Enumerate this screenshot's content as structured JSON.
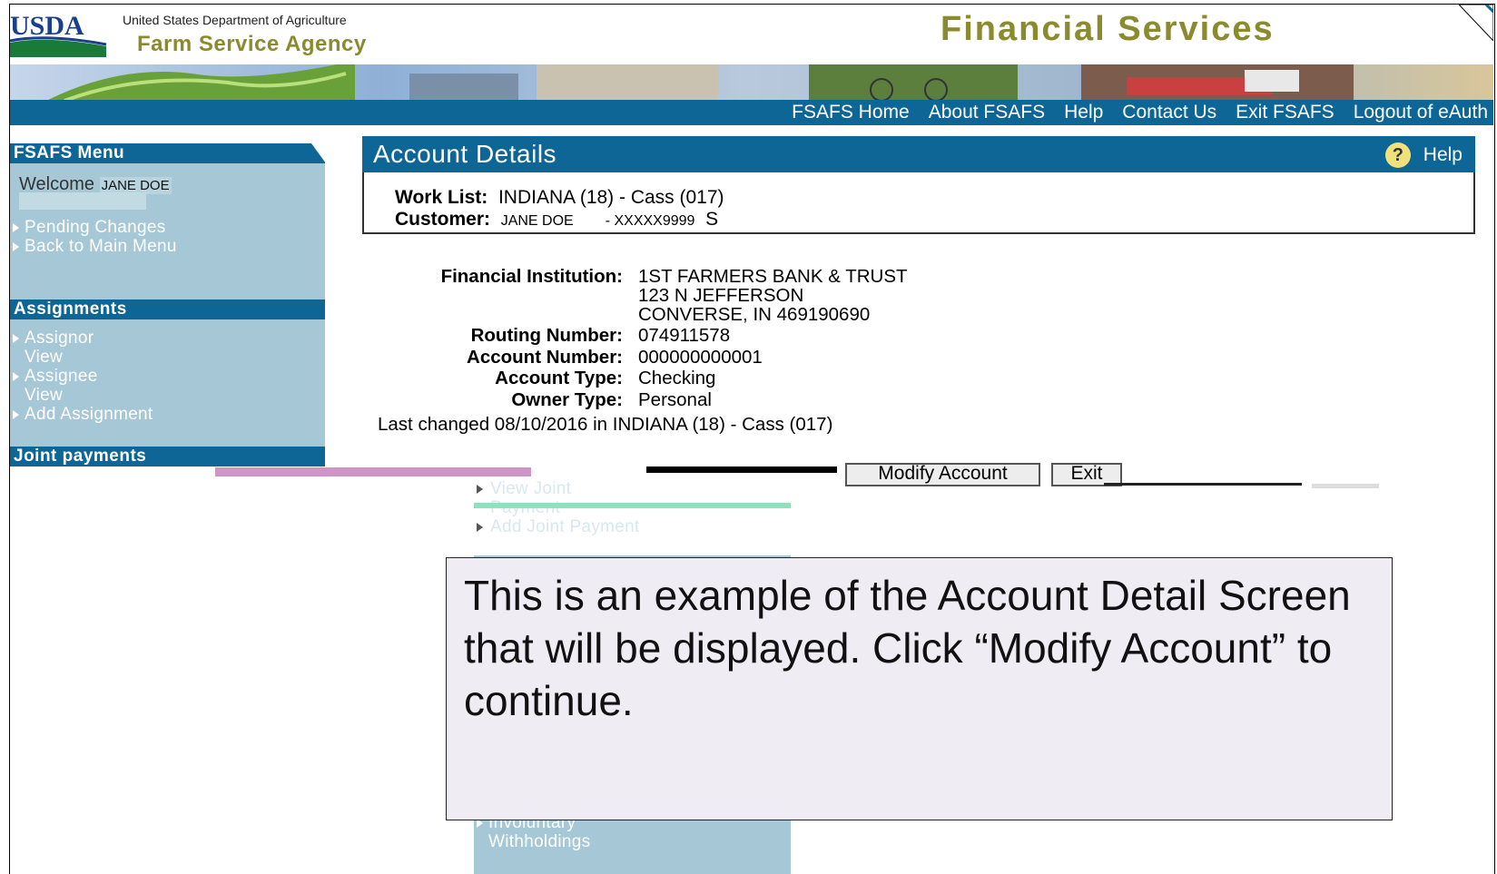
{
  "header": {
    "logo_text": "USDA",
    "department": "United States Department of Agriculture",
    "agency": "Farm Service Agency",
    "site_title": "Financial Services"
  },
  "topnav": {
    "links": [
      "FSAFS Home",
      "About FSAFS",
      "Help",
      "Contact Us",
      "Exit FSAFS",
      "Logout of eAuth"
    ]
  },
  "sidebar": {
    "menu_title": "FSAFS Menu",
    "welcome_label": "Welcome",
    "welcome_name": "JANE DOE",
    "main_items": [
      {
        "label": "Pending Changes"
      },
      {
        "label": "Back to Main Menu"
      }
    ],
    "assignments_title": "Assignments",
    "assignment_items": [
      {
        "label": "Assignor View"
      },
      {
        "label": "Assignee View"
      },
      {
        "label": "Add Assignment"
      }
    ],
    "joint_title": "Joint payments",
    "joint_items": [
      {
        "label": "View Joint Payment"
      },
      {
        "label": "Add Joint Payment"
      }
    ],
    "lower_items": [
      {
        "label": "Involuntary Withholdings"
      }
    ]
  },
  "account": {
    "title": "Account Details",
    "help_label": "Help",
    "worklist_label": "Work List:",
    "worklist_value": "INDIANA (18) - Cass (017)",
    "customer_label": "Customer:",
    "customer_name": "JANE DOE",
    "customer_id": "- XXXXX9999",
    "customer_suffix": "S",
    "fi_label": "Financial Institution:",
    "fi_line1": "1ST FARMERS BANK & TRUST",
    "fi_line2": "123 N JEFFERSON",
    "fi_line3": "CONVERSE, IN 469190690",
    "routing_label": "Routing Number:",
    "routing_value": "074911578",
    "account_label": "Account Number:",
    "account_value": "000000000001",
    "type_label": "Account Type:",
    "type_value": "Checking",
    "owner_label": "Owner Type:",
    "owner_value": "Personal",
    "last_changed": "Last changed 08/10/2016 in INDIANA (18) - Cass (017)"
  },
  "buttons": {
    "modify": "Modify Account",
    "exit": "Exit"
  },
  "callout": {
    "text": "This is an example of the Account Detail Screen that will be displayed.  Click “Modify Account” to continue."
  },
  "colors": {
    "nav_blue": "#0e6696",
    "menu_bg": "#a6c8d6",
    "olive": "#8a8a2e"
  }
}
